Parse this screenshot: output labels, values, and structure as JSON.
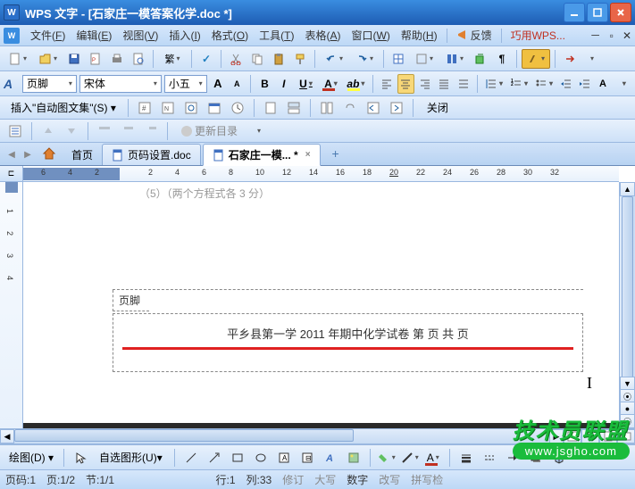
{
  "titlebar": {
    "app_icon": "W",
    "title": "WPS 文字 - [石家庄一模答案化学.doc *]"
  },
  "menubar": {
    "icon": "W",
    "items": [
      {
        "label": "文件",
        "key": "F"
      },
      {
        "label": "编辑",
        "key": "E"
      },
      {
        "label": "视图",
        "key": "V"
      },
      {
        "label": "插入",
        "key": "I"
      },
      {
        "label": "格式",
        "key": "O"
      },
      {
        "label": "工具",
        "key": "T"
      },
      {
        "label": "表格",
        "key": "A"
      },
      {
        "label": "窗口",
        "key": "W"
      },
      {
        "label": "帮助",
        "key": "H"
      }
    ],
    "feedback": "反馈",
    "promo": "巧用WPS..."
  },
  "formatbar": {
    "style": "页脚",
    "font": "宋体",
    "size": "小五"
  },
  "autotext": {
    "label": "插入\"自动图文集\"(S)",
    "close": "关闭"
  },
  "updatebar": {
    "update": "更新目录"
  },
  "tabs": {
    "home": "首页",
    "items": [
      {
        "label": "页码设置.doc",
        "active": false
      },
      {
        "label": "石家庄一模... *",
        "active": true
      }
    ]
  },
  "ruler": {
    "h_ticks": [
      "6",
      "4",
      "2",
      "",
      "2",
      "4",
      "6",
      "8",
      "10",
      "12",
      "14",
      "16",
      "18",
      "20",
      "22",
      "24",
      "26",
      "28",
      "30",
      "32"
    ]
  },
  "document": {
    "top_text": "（5）（两个方程式各 3 分）",
    "footer_label": "页脚",
    "footer_text": "平乡县第一学 2011 年期中化学试卷    第    页  共    页"
  },
  "drawingbar": {
    "label": "绘图(D)",
    "autoshape": "自选图形(U)"
  },
  "statusbar": {
    "page_code": "页码:1",
    "page": "页:1/2",
    "section": "节:1/1",
    "line": "行:1",
    "col": "列:33",
    "rev": "修订",
    "caps": "大写",
    "num": "数字",
    "ovr": "改写",
    "spell": "拼写检"
  },
  "watermark": {
    "top": "技术员联盟",
    "bottom": "www.jsgho.com"
  }
}
